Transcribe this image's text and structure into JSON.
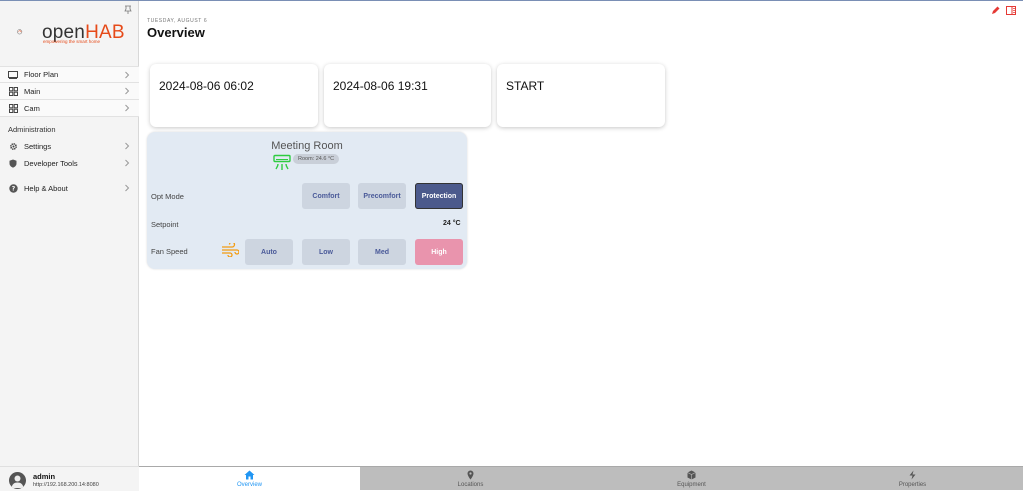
{
  "app": {
    "logo_name": "openHAB",
    "logo_prefix": "open",
    "logo_suffix": "HAB",
    "logo_tagline": "empowering the smart home"
  },
  "sidebar": {
    "items": [
      {
        "label": "Floor Plan",
        "icon": "floorplan-icon"
      },
      {
        "label": "Main",
        "icon": "grid-icon"
      },
      {
        "label": "Cam",
        "icon": "grid-icon"
      }
    ],
    "admin_title": "Administration",
    "admin_items": [
      {
        "label": "Settings",
        "icon": "gear-icon"
      },
      {
        "label": "Developer Tools",
        "icon": "shield-icon"
      }
    ],
    "help": {
      "label": "Help & About",
      "icon": "help-icon"
    }
  },
  "user": {
    "name": "admin",
    "url": "http://192.168.200.14:8080"
  },
  "header": {
    "date": "TUESDAY, AUGUST 6",
    "title": "Overview"
  },
  "cards": [
    {
      "value": "2024-08-06 06:02"
    },
    {
      "value": "2024-08-06 19:31"
    },
    {
      "value": "START"
    }
  ],
  "room": {
    "title": "Meeting Room",
    "temp_badge": "Room: 24.6 °C",
    "opt_mode_label": "Opt Mode",
    "opt_modes": [
      "Comfort",
      "Precomfort",
      "Protection"
    ],
    "opt_mode_selected": "Protection",
    "setpoint_label": "Setpoint",
    "setpoint_value": "24 °C",
    "fan_label": "Fan Speed",
    "fan_speeds": [
      "Auto",
      "Low",
      "Med",
      "High"
    ],
    "fan_selected": "High"
  },
  "tabs": [
    {
      "label": "Overview",
      "icon": "home-icon",
      "selected": true
    },
    {
      "label": "Locations",
      "icon": "location-pin-icon",
      "selected": false
    },
    {
      "label": "Equipment",
      "icon": "cube-icon",
      "selected": false
    },
    {
      "label": "Properties",
      "icon": "bolt-icon",
      "selected": false
    }
  ],
  "colors": {
    "brand": "#e64a19",
    "accent": "#2196f3",
    "active_button": "#4c5a8c",
    "high_button": "#e994ad",
    "ac_icon": "#2ecc40",
    "fan_icon": "#f39c12"
  }
}
